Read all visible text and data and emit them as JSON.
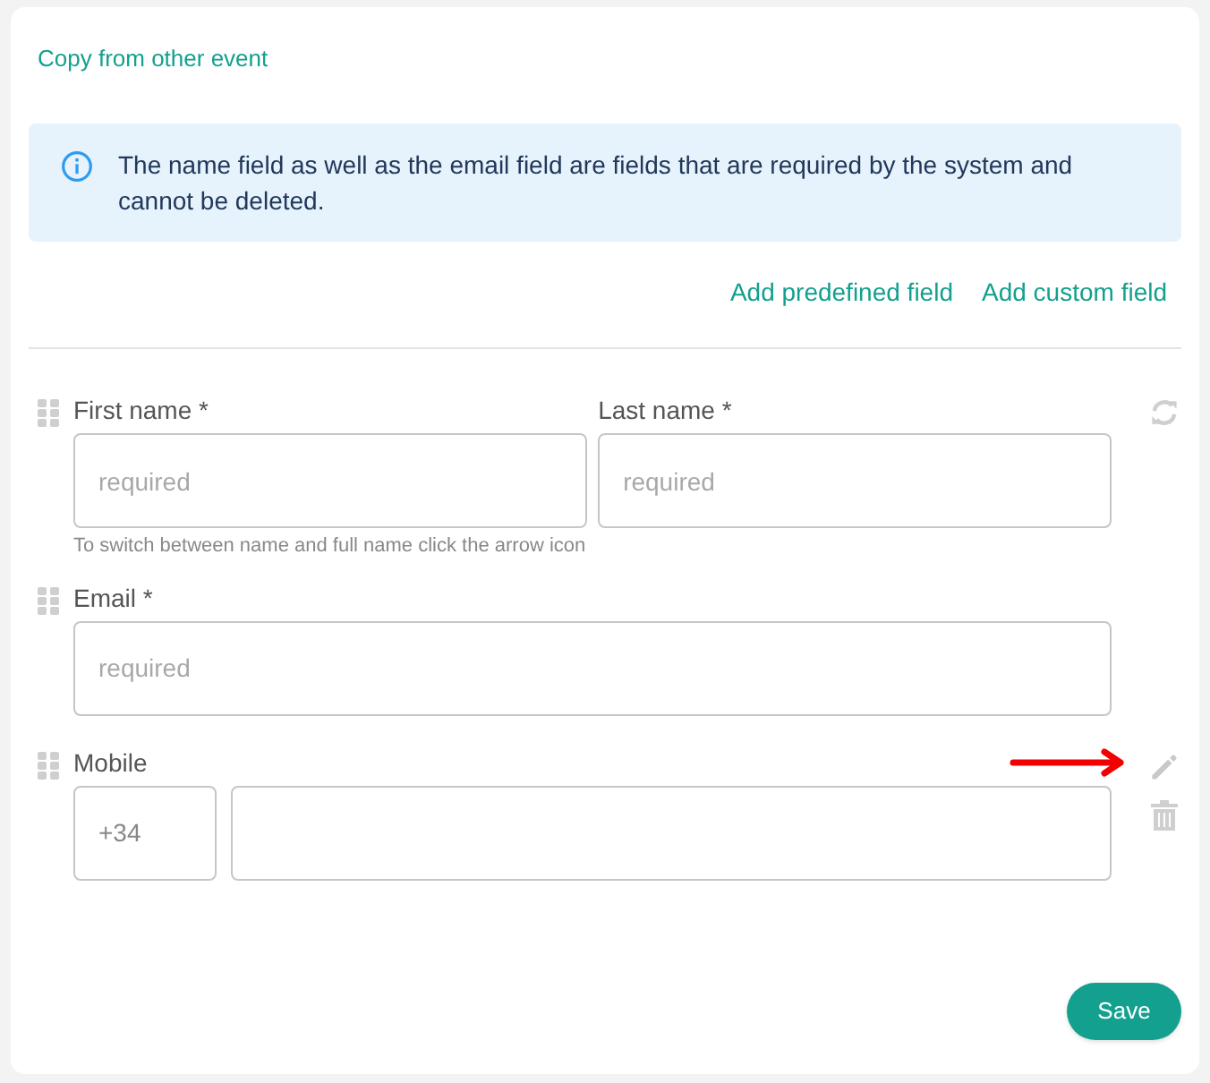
{
  "copy_link": "Copy from other event",
  "notice": "The name field as well as the email field are fields that are required by the system and cannot be deleted.",
  "actions": [
    "Add predefined field",
    "Add custom field"
  ],
  "fields": [
    {
      "kind": "pair",
      "inputs": [
        {
          "label": "First name *",
          "placeholder": "required"
        },
        {
          "label": "Last name *",
          "placeholder": "required"
        }
      ],
      "hint": "To switch between name and full name click the arrow icon"
    },
    {
      "kind": "single",
      "inputs": [
        {
          "label": "Email *",
          "placeholder": "required"
        }
      ]
    },
    {
      "kind": "phone",
      "label": "Mobile",
      "inputs": [
        {
          "value": "+34"
        }
      ]
    }
  ],
  "save": "Save"
}
